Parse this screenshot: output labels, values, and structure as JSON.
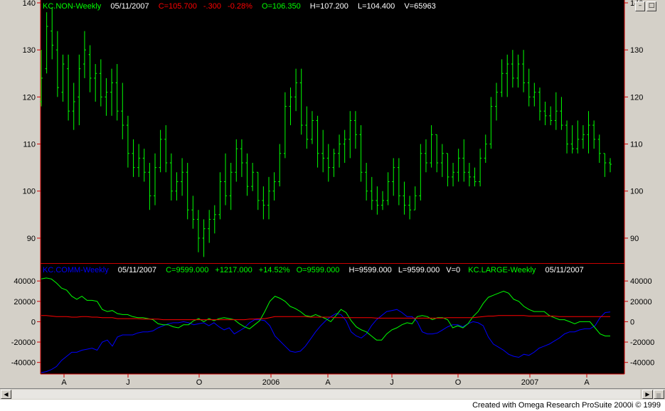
{
  "colors": {
    "bg": "#000000",
    "frame": "#d4d0c8",
    "price": "#00ff00",
    "axis": "#cc0000",
    "comm": "#0000ff",
    "large": "#00ff00",
    "small": "#ff0000",
    "label_green": "#00ff00",
    "label_red": "#ff0000",
    "label_white": "#ffffff"
  },
  "window_buttons": {
    "minimize": "–",
    "restore": "□"
  },
  "price_pane": {
    "symbol_label": "KC.NON-Weekly",
    "date": "05/11/2007",
    "close": "C=105.700",
    "change": "-.300",
    "pct": "-0.28%",
    "open": "O=106.350",
    "high": "H=107.200",
    "low": "L=104.400",
    "volume": "V=65963",
    "y_ticks": [
      "140",
      "130",
      "120",
      "110",
      "100",
      "90"
    ]
  },
  "cot_pane": {
    "symbol_label": "KC.COMM-Weekly",
    "date": "05/11/2007",
    "close": "C=9599.000",
    "change": "+1217.000",
    "pct": "+14.52%",
    "open": "O=9599.000",
    "high": "H=9599.000",
    "low": "L=9599.000",
    "volume": "V=0",
    "label2": "KC.LARGE-Weekly",
    "date2": "05/11/2007",
    "y_ticks": [
      "40000",
      "20000",
      "0",
      "-20000",
      "-40000"
    ]
  },
  "x_axis": {
    "labels": [
      "A",
      "J",
      "O",
      "2006",
      "A",
      "J",
      "O",
      "2007",
      "A"
    ]
  },
  "footer": {
    "credit": "Created with Omega Research ProSuite 2000i © 1999"
  },
  "chart_data": [
    {
      "type": "ohlc",
      "title": "KC.NON-Weekly",
      "ylim": [
        85,
        140
      ],
      "ohlc_bars": [
        {
          "o": 119,
          "h": 130,
          "l": 118,
          "c": 124
        },
        {
          "o": 126,
          "h": 138,
          "l": 125,
          "c": 135
        },
        {
          "o": 134,
          "h": 139,
          "l": 128,
          "c": 131
        },
        {
          "o": 130,
          "h": 134,
          "l": 120,
          "c": 122
        },
        {
          "o": 121,
          "h": 129,
          "l": 119,
          "c": 127
        },
        {
          "o": 126,
          "h": 129,
          "l": 115,
          "c": 117
        },
        {
          "o": 117,
          "h": 123,
          "l": 113,
          "c": 119
        },
        {
          "o": 120,
          "h": 129,
          "l": 114,
          "c": 126
        },
        {
          "o": 127,
          "h": 134,
          "l": 124,
          "c": 130
        },
        {
          "o": 129,
          "h": 131,
          "l": 121,
          "c": 124
        },
        {
          "o": 124,
          "h": 127,
          "l": 119,
          "c": 125
        },
        {
          "o": 125,
          "h": 128,
          "l": 118,
          "c": 120
        },
        {
          "o": 120,
          "h": 124,
          "l": 116,
          "c": 121
        },
        {
          "o": 121,
          "h": 126,
          "l": 116,
          "c": 123
        },
        {
          "o": 123,
          "h": 127,
          "l": 115,
          "c": 117
        },
        {
          "o": 117,
          "h": 123,
          "l": 111,
          "c": 114
        },
        {
          "o": 114,
          "h": 116,
          "l": 105,
          "c": 108
        },
        {
          "o": 108,
          "h": 111,
          "l": 103,
          "c": 105
        },
        {
          "o": 105,
          "h": 110,
          "l": 103,
          "c": 107
        },
        {
          "o": 107,
          "h": 109,
          "l": 102,
          "c": 104
        },
        {
          "o": 104,
          "h": 106,
          "l": 96,
          "c": 99
        },
        {
          "o": 99,
          "h": 108,
          "l": 97,
          "c": 105
        },
        {
          "o": 105,
          "h": 113,
          "l": 104,
          "c": 111
        },
        {
          "o": 111,
          "h": 114,
          "l": 104,
          "c": 106
        },
        {
          "o": 106,
          "h": 108,
          "l": 98,
          "c": 100
        },
        {
          "o": 100,
          "h": 104,
          "l": 98,
          "c": 102
        },
        {
          "o": 102,
          "h": 107,
          "l": 99,
          "c": 104
        },
        {
          "o": 104,
          "h": 106,
          "l": 94,
          "c": 96
        },
        {
          "o": 96,
          "h": 99,
          "l": 92,
          "c": 94
        },
        {
          "o": 94,
          "h": 96,
          "l": 87,
          "c": 90
        },
        {
          "o": 90,
          "h": 94,
          "l": 86,
          "c": 92
        },
        {
          "o": 92,
          "h": 96,
          "l": 89,
          "c": 94
        },
        {
          "o": 94,
          "h": 97,
          "l": 91,
          "c": 95
        },
        {
          "o": 95,
          "h": 104,
          "l": 94,
          "c": 102
        },
        {
          "o": 102,
          "h": 108,
          "l": 97,
          "c": 99
        },
        {
          "o": 99,
          "h": 106,
          "l": 96,
          "c": 104
        },
        {
          "o": 104,
          "h": 111,
          "l": 102,
          "c": 109
        },
        {
          "o": 109,
          "h": 111,
          "l": 103,
          "c": 106
        },
        {
          "o": 106,
          "h": 108,
          "l": 99,
          "c": 101
        },
        {
          "o": 101,
          "h": 106,
          "l": 100,
          "c": 104
        },
        {
          "o": 104,
          "h": 104,
          "l": 96,
          "c": 98
        },
        {
          "o": 98,
          "h": 101,
          "l": 94,
          "c": 97
        },
        {
          "o": 97,
          "h": 103,
          "l": 94,
          "c": 100
        },
        {
          "o": 100,
          "h": 104,
          "l": 98,
          "c": 102
        },
        {
          "o": 102,
          "h": 110,
          "l": 101,
          "c": 108
        },
        {
          "o": 108,
          "h": 121,
          "l": 107,
          "c": 118
        },
        {
          "o": 118,
          "h": 122,
          "l": 114,
          "c": 120
        },
        {
          "o": 120,
          "h": 126,
          "l": 117,
          "c": 123
        },
        {
          "o": 123,
          "h": 126,
          "l": 112,
          "c": 114
        },
        {
          "o": 114,
          "h": 118,
          "l": 109,
          "c": 111
        },
        {
          "o": 111,
          "h": 117,
          "l": 110,
          "c": 115
        },
        {
          "o": 115,
          "h": 116,
          "l": 105,
          "c": 108
        },
        {
          "o": 108,
          "h": 113,
          "l": 104,
          "c": 107
        },
        {
          "o": 107,
          "h": 110,
          "l": 102,
          "c": 105
        },
        {
          "o": 105,
          "h": 109,
          "l": 103,
          "c": 108
        },
        {
          "o": 108,
          "h": 112,
          "l": 105,
          "c": 110
        },
        {
          "o": 110,
          "h": 113,
          "l": 106,
          "c": 111
        },
        {
          "o": 111,
          "h": 117,
          "l": 107,
          "c": 115
        },
        {
          "o": 115,
          "h": 117,
          "l": 109,
          "c": 112
        },
        {
          "o": 112,
          "h": 114,
          "l": 102,
          "c": 104
        },
        {
          "o": 104,
          "h": 106,
          "l": 98,
          "c": 100
        },
        {
          "o": 100,
          "h": 103,
          "l": 96,
          "c": 98
        },
        {
          "o": 98,
          "h": 101,
          "l": 95,
          "c": 97
        },
        {
          "o": 97,
          "h": 100,
          "l": 96,
          "c": 98
        },
        {
          "o": 98,
          "h": 104,
          "l": 97,
          "c": 102
        },
        {
          "o": 102,
          "h": 107,
          "l": 99,
          "c": 105
        },
        {
          "o": 105,
          "h": 107,
          "l": 97,
          "c": 99
        },
        {
          "o": 99,
          "h": 102,
          "l": 95,
          "c": 97
        },
        {
          "o": 97,
          "h": 99,
          "l": 94,
          "c": 96
        },
        {
          "o": 96,
          "h": 101,
          "l": 96,
          "c": 99
        },
        {
          "o": 99,
          "h": 110,
          "l": 98,
          "c": 108
        },
        {
          "o": 108,
          "h": 111,
          "l": 104,
          "c": 106
        },
        {
          "o": 106,
          "h": 114,
          "l": 105,
          "c": 112
        },
        {
          "o": 112,
          "h": 112,
          "l": 104,
          "c": 106
        },
        {
          "o": 106,
          "h": 110,
          "l": 103,
          "c": 108
        },
        {
          "o": 108,
          "h": 108,
          "l": 101,
          "c": 103
        },
        {
          "o": 103,
          "h": 106,
          "l": 101,
          "c": 104
        },
        {
          "o": 104,
          "h": 109,
          "l": 102,
          "c": 107
        },
        {
          "o": 107,
          "h": 111,
          "l": 102,
          "c": 104
        },
        {
          "o": 104,
          "h": 106,
          "l": 101,
          "c": 103
        },
        {
          "o": 103,
          "h": 105,
          "l": 101,
          "c": 102
        },
        {
          "o": 102,
          "h": 109,
          "l": 101,
          "c": 107
        },
        {
          "o": 107,
          "h": 112,
          "l": 106,
          "c": 110
        },
        {
          "o": 110,
          "h": 120,
          "l": 109,
          "c": 118
        },
        {
          "o": 118,
          "h": 123,
          "l": 115,
          "c": 121
        },
        {
          "o": 121,
          "h": 128,
          "l": 120,
          "c": 125
        },
        {
          "o": 125,
          "h": 129,
          "l": 120,
          "c": 127
        },
        {
          "o": 127,
          "h": 130,
          "l": 122,
          "c": 124
        },
        {
          "o": 124,
          "h": 129,
          "l": 122,
          "c": 127
        },
        {
          "o": 127,
          "h": 130,
          "l": 121,
          "c": 123
        },
        {
          "o": 123,
          "h": 126,
          "l": 118,
          "c": 120
        },
        {
          "o": 120,
          "h": 123,
          "l": 118,
          "c": 121
        },
        {
          "o": 121,
          "h": 122,
          "l": 115,
          "c": 117
        },
        {
          "o": 117,
          "h": 119,
          "l": 114,
          "c": 116
        },
        {
          "o": 116,
          "h": 118,
          "l": 114,
          "c": 115
        },
        {
          "o": 115,
          "h": 121,
          "l": 113,
          "c": 117
        },
        {
          "o": 117,
          "h": 120,
          "l": 113,
          "c": 114
        },
        {
          "o": 114,
          "h": 115,
          "l": 108,
          "c": 110
        },
        {
          "o": 110,
          "h": 114,
          "l": 108,
          "c": 109
        },
        {
          "o": 109,
          "h": 115,
          "l": 108,
          "c": 111
        },
        {
          "o": 111,
          "h": 114,
          "l": 109,
          "c": 112
        },
        {
          "o": 112,
          "h": 117,
          "l": 108,
          "c": 114
        },
        {
          "o": 114,
          "h": 115,
          "l": 109,
          "c": 111
        },
        {
          "o": 111,
          "h": 112,
          "l": 106,
          "c": 108
        },
        {
          "o": 108,
          "h": 108,
          "l": 103,
          "c": 106
        },
        {
          "o": 106,
          "h": 107,
          "l": 104,
          "c": 105.7
        }
      ]
    },
    {
      "type": "line",
      "title": "KC.COMM-Weekly / KC.LARGE-Weekly",
      "ylim": [
        -50000,
        45000
      ],
      "series": [
        {
          "name": "KC.COMM-Weekly",
          "color": "#0000ff",
          "values": [
            -50000,
            -49000,
            -47000,
            -44000,
            -38000,
            -34000,
            -30000,
            -30000,
            -28000,
            -27000,
            -26000,
            -28000,
            -20000,
            -18000,
            -24000,
            -15000,
            -13000,
            -13000,
            -13000,
            -11000,
            -10000,
            -10000,
            -9000,
            -6000,
            -4000,
            -2000,
            -1000,
            -1000,
            0,
            -1000,
            -3000,
            -2000,
            -1000,
            -4000,
            -1000,
            -5000,
            -8000,
            -6000,
            -12000,
            -9000,
            -6000,
            -1000,
            2000,
            2000,
            1000,
            -4000,
            -14000,
            -19000,
            -24000,
            -29000,
            -30000,
            -29000,
            -24000,
            -17000,
            -10000,
            -4000,
            1000,
            5000,
            8000,
            7000,
            1000,
            -10000,
            -14000,
            -16000,
            -12000,
            -4000,
            2000,
            6000,
            10000,
            11000,
            12000,
            9000,
            5000,
            5000,
            0,
            -10000,
            -12000,
            -12000,
            -11000,
            -8000,
            -5000,
            -3000,
            -3000,
            -5000,
            -2000,
            0,
            -1000,
            -4000,
            -15000,
            -22000,
            -25000,
            -28000,
            -32000,
            -34000,
            -35000,
            -32000,
            -33000,
            -30000,
            -26000,
            -24000,
            -22000,
            -19000,
            -16000,
            -12000,
            -10000,
            -10000,
            -8000,
            -7000,
            -7000,
            -4000,
            4000,
            9000,
            9599
          ]
        },
        {
          "name": "KC.LARGE-Weekly",
          "color": "#00ff00",
          "values": [
            42000,
            43000,
            42000,
            38000,
            33000,
            31000,
            25000,
            22000,
            25000,
            21000,
            21000,
            20000,
            12000,
            10000,
            11000,
            8000,
            7000,
            7000,
            5000,
            4000,
            4000,
            3000,
            2000,
            -2000,
            -3000,
            -3000,
            -5000,
            -6000,
            -3000,
            -3000,
            1000,
            3000,
            0,
            3000,
            1000,
            3000,
            4000,
            3000,
            2000,
            -2000,
            -5000,
            -7000,
            -3000,
            1000,
            10000,
            20000,
            25000,
            23000,
            20000,
            15000,
            13000,
            10000,
            6000,
            5000,
            7000,
            5000,
            3000,
            0,
            6000,
            12000,
            9000,
            1000,
            -5000,
            -8000,
            -10000,
            -14000,
            -18000,
            -18000,
            -12000,
            -8000,
            -6000,
            -3000,
            -1000,
            -2000,
            5000,
            6000,
            5000,
            2000,
            4000,
            4000,
            2000,
            -6000,
            -4000,
            -6000,
            -2000,
            5000,
            10000,
            18000,
            24000,
            26000,
            28000,
            30000,
            28000,
            22000,
            20000,
            15000,
            12000,
            10000,
            10000,
            10000,
            6000,
            4000,
            2000,
            2000,
            0,
            -2000,
            0,
            0,
            0,
            -6000,
            -12000,
            -14000,
            -14000
          ]
        },
        {
          "name": "",
          "color": "#ff0000",
          "values": [
            6000,
            6000,
            5500,
            5000,
            5000,
            5000,
            4500,
            4500,
            5000,
            5000,
            4500,
            4500,
            4000,
            4000,
            4000,
            3000,
            3000,
            3000,
            3000,
            3000,
            2500,
            2500,
            2500,
            2500,
            2000,
            2000,
            2000,
            2000,
            2000,
            2000,
            2000,
            2000,
            2000,
            2000,
            2000,
            2000,
            2000,
            2000,
            2000,
            2000,
            2000,
            2500,
            2500,
            3000,
            3000,
            4000,
            5000,
            5000,
            5000,
            5000,
            5000,
            5000,
            5000,
            4500,
            4500,
            4500,
            4500,
            4500,
            4000,
            4000,
            4000,
            4000,
            4000,
            4000,
            4000,
            4000,
            3500,
            3500,
            3500,
            3500,
            3500,
            3500,
            3500,
            3500,
            3500,
            3500,
            3500,
            3500,
            3500,
            3500,
            4000,
            4000,
            4000,
            4000,
            4000,
            4000,
            4500,
            5000,
            5500,
            5500,
            6000,
            6000,
            6000,
            6000,
            6000,
            6000,
            5500,
            5500,
            5500,
            5500,
            5500,
            5500,
            5000,
            5000,
            5000,
            5000,
            5000,
            5000,
            5000,
            5000,
            5000,
            5000,
            5000
          ]
        }
      ]
    }
  ]
}
